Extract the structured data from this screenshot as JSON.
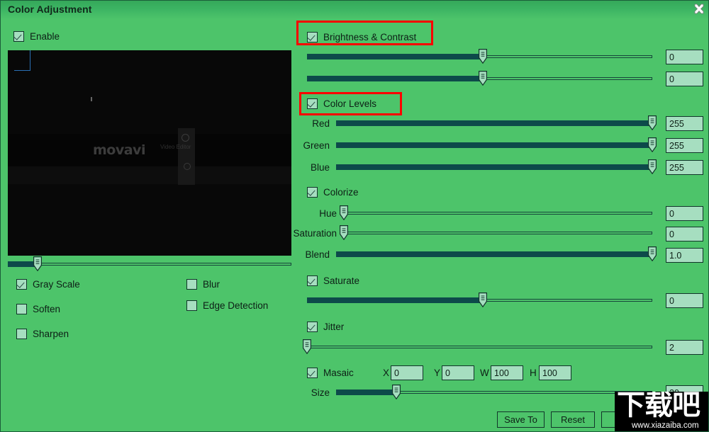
{
  "window": {
    "title": "Color Adjustment",
    "close_icon": "close-x-icon"
  },
  "left_panel": {
    "enable": {
      "label": "Enable",
      "checked": true
    },
    "preview": {
      "logo_text": "movavi",
      "logo_sub": "Video Editor",
      "position_value": 12
    },
    "filters": [
      {
        "label": "Gray Scale",
        "checked": true
      },
      {
        "label": "Soften",
        "checked": false
      },
      {
        "label": "Sharpen",
        "checked": false
      },
      {
        "label": "Blur",
        "checked": false
      },
      {
        "label": "Edge Detection",
        "checked": false
      }
    ]
  },
  "right_panel": {
    "brightness_contrast": {
      "label": "Brightness & Contrast",
      "checked": true,
      "highlighted": true,
      "sliders": [
        {
          "name": "brightness",
          "value": "0",
          "fill_percent": 51
        },
        {
          "name": "contrast",
          "value": "0",
          "fill_percent": 51
        }
      ]
    },
    "color_levels": {
      "label": "Color Levels",
      "checked": true,
      "highlighted": true,
      "sliders": [
        {
          "label": "Red",
          "value": "255",
          "fill_percent": 100
        },
        {
          "label": "Green",
          "value": "255",
          "fill_percent": 100
        },
        {
          "label": "Blue",
          "value": "255",
          "fill_percent": 100
        }
      ]
    },
    "colorize": {
      "label": "Colorize",
      "checked": true,
      "sliders": [
        {
          "label": "Hue",
          "value": "0",
          "fill_percent": 0
        },
        {
          "label": "Saturation",
          "value": "0",
          "fill_percent": 0
        },
        {
          "label": "Blend",
          "value": "1.0",
          "fill_percent": 100
        }
      ]
    },
    "saturate": {
      "label": "Saturate",
      "checked": true,
      "slider": {
        "value": "0",
        "fill_percent": 51
      }
    },
    "jitter": {
      "label": "Jitter",
      "checked": true,
      "slider": {
        "value": "2",
        "fill_percent": 0
      }
    },
    "masaic": {
      "label": "Masaic",
      "checked": true,
      "fields": [
        {
          "label": "X",
          "value": "0"
        },
        {
          "label": "Y",
          "value": "0"
        },
        {
          "label": "W",
          "value": "100"
        },
        {
          "label": "H",
          "value": "100"
        }
      ],
      "size": {
        "label": "Size",
        "value": "20",
        "fill_percent": 22
      }
    }
  },
  "buttons": {
    "save_to": "Save To",
    "reset": "Reset",
    "third": ""
  },
  "watermark": {
    "text_cn": "下载吧",
    "url": "www.xiazaiba.com"
  },
  "colors": {
    "background": "#4dc46a",
    "track_fill": "#0d4a4a",
    "field_bg": "#a6dec0",
    "border": "#11352a",
    "highlight": "#ff0000"
  }
}
